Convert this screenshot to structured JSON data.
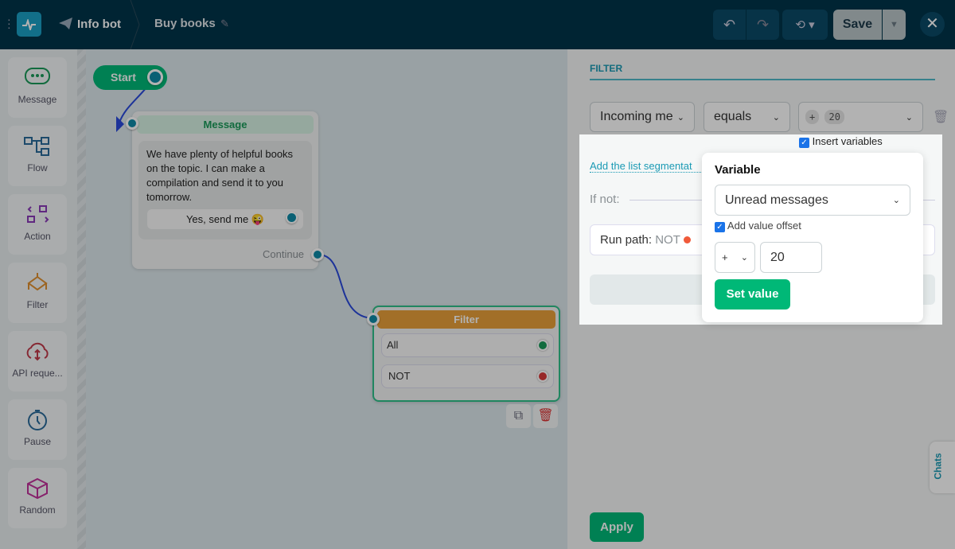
{
  "header": {
    "bot_name": "Info bot",
    "flow_name": "Buy books",
    "save_label": "Save"
  },
  "sidebar": {
    "items": [
      {
        "label": "Message",
        "icon": "message-icon"
      },
      {
        "label": "Flow",
        "icon": "flow-icon"
      },
      {
        "label": "Action",
        "icon": "action-icon"
      },
      {
        "label": "Filter",
        "icon": "filter-icon"
      },
      {
        "label": "API reque...",
        "icon": "cloud-icon"
      },
      {
        "label": "Pause",
        "icon": "timer-icon"
      },
      {
        "label": "Random",
        "icon": "dice-icon"
      }
    ]
  },
  "canvas": {
    "start_label": "Start",
    "message_node": {
      "title": "Message",
      "text": "We have plenty of helpful books on the topic. I can make a compilation and send it to you tomorrow.",
      "button": "Yes, send me 😜",
      "continue": "Continue"
    },
    "filter_node": {
      "title": "Filter",
      "paths": [
        "All",
        "NOT"
      ]
    }
  },
  "panel": {
    "title": "FILTER",
    "field": "Incoming me",
    "operator": "equals",
    "value_sign": "+",
    "value_num": "20",
    "insert_variables": "Insert variables",
    "add_link": "Add the list segmentat",
    "if_not": "If not:",
    "run_path_label": "Run path:",
    "run_path_value": "NOT",
    "apply": "Apply",
    "chats": "Chats"
  },
  "popover": {
    "title": "Variable",
    "variable": "Unread messages",
    "offset_label": "Add value offset",
    "sign": "+",
    "offset": "20",
    "set_value": "Set value"
  },
  "colors": {
    "accent": "#00b877",
    "teal": "#1ba0c4",
    "filter": "#e9a03a"
  }
}
